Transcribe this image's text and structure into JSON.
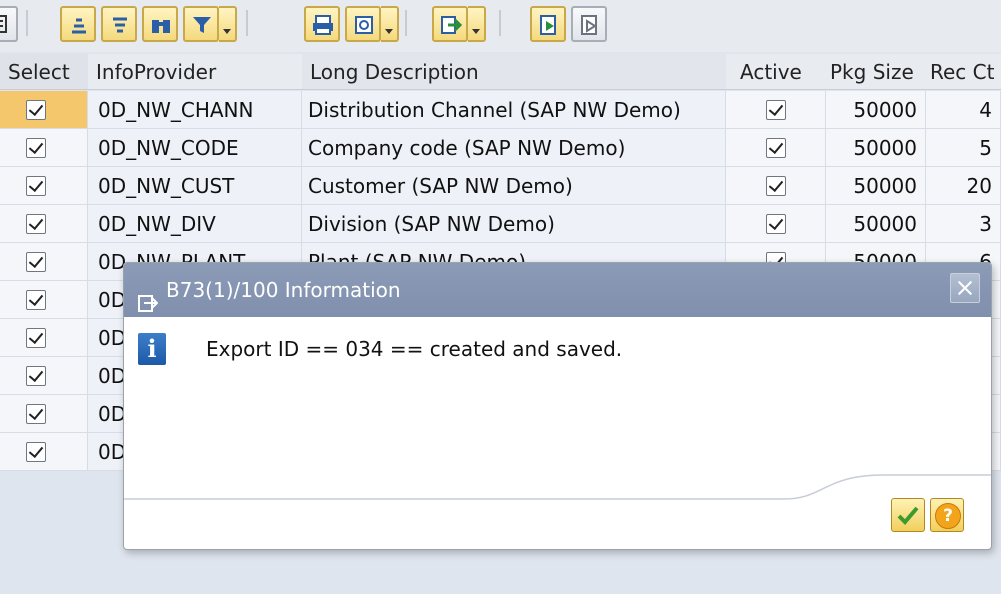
{
  "toolbar": {
    "buttons": [
      "details-icon",
      "sort-ascending-icon",
      "sort-descending-icon",
      "find-icon",
      "filter-icon",
      "print-icon",
      "layout-icon",
      "export-icon",
      "select-all-icon",
      "deselect-all-icon"
    ]
  },
  "table": {
    "headers": {
      "select": "Select",
      "infoprovider": "InfoProvider",
      "long_description": "Long Description",
      "active": "Active",
      "pkg_size": "Pkg Size",
      "rec_ct": "Rec Ct"
    },
    "rows": [
      {
        "infoprovider": "0D_NW_CHANN",
        "description": "Distribution Channel (SAP NW Demo)",
        "pkg_size": "50000",
        "rec_ct": "4"
      },
      {
        "infoprovider": "0D_NW_CODE",
        "description": "Company code (SAP NW Demo)",
        "pkg_size": "50000",
        "rec_ct": "5"
      },
      {
        "infoprovider": "0D_NW_CUST",
        "description": "Customer (SAP NW Demo)",
        "pkg_size": "50000",
        "rec_ct": "20"
      },
      {
        "infoprovider": "0D_NW_DIV",
        "description": "Division (SAP NW Demo)",
        "pkg_size": "50000",
        "rec_ct": "3"
      },
      {
        "infoprovider": "0D_NW_PLANT",
        "description": "Plant (SAP NW Demo)",
        "pkg_size": "50000",
        "rec_ct": "6"
      },
      {
        "infoprovider": "0D"
      },
      {
        "infoprovider": "0D"
      },
      {
        "infoprovider": "0D"
      },
      {
        "infoprovider": "0D"
      },
      {
        "infoprovider": "0D"
      }
    ]
  },
  "dialog": {
    "title": "B73(1)/100 Information",
    "message": "Export ID == 034 == created and saved.",
    "ok_icon": "checkmark-icon",
    "help_icon": "help-icon",
    "help_glyph": "?"
  },
  "colors": {
    "title_bar": "#8c9bb6",
    "selected_cell": "#f5c76d",
    "button_yellow": "#f2cf5c"
  }
}
